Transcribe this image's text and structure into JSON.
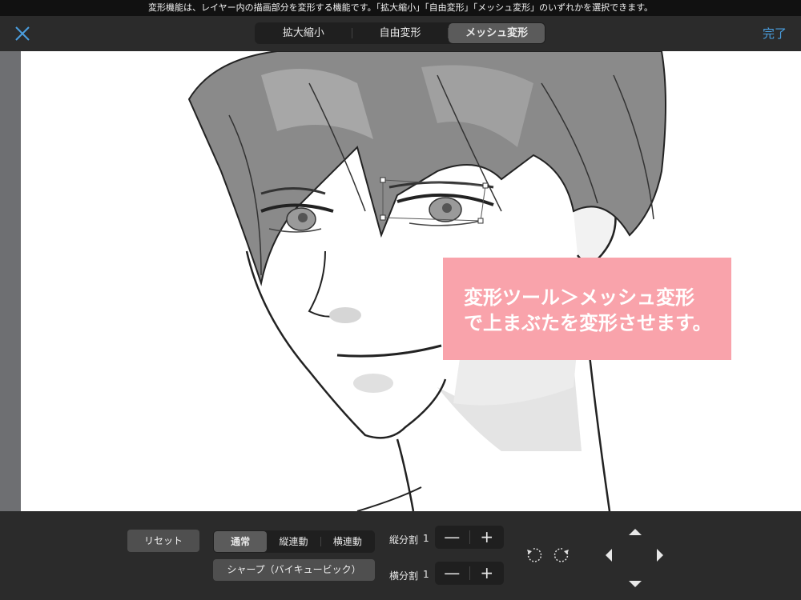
{
  "hint": "変形機能は、レイヤー内の描画部分を変形する機能です。「拡大縮小」「自由変形」「メッシュ変形」のいずれかを選択できます。",
  "header": {
    "close_icon": "close-icon",
    "tabs": [
      {
        "label": "拡大縮小",
        "active": false
      },
      {
        "label": "自由変形",
        "active": false
      },
      {
        "label": "メッシュ変形",
        "active": true
      }
    ],
    "done_label": "完了"
  },
  "callout": {
    "line1": "変形ツール＞メッシュ変形",
    "line2": "で上まぶたを変形させます。"
  },
  "controls": {
    "reset_label": "リセット",
    "modes": [
      {
        "label": "通常",
        "active": true
      },
      {
        "label": "縦連動",
        "active": false
      },
      {
        "label": "横連動",
        "active": false
      }
    ],
    "interpolation_label": "シャープ（バイキュービック）",
    "vertical_div_label": "縦分割",
    "vertical_div_value": "1",
    "horizontal_div_label": "横分割",
    "horizontal_div_value": "1",
    "minus": "—",
    "plus": "+"
  },
  "colors": {
    "accent": "#4a9fe0",
    "callout_bg": "#f9a3ab",
    "panel_bg": "#2b2b2b"
  }
}
